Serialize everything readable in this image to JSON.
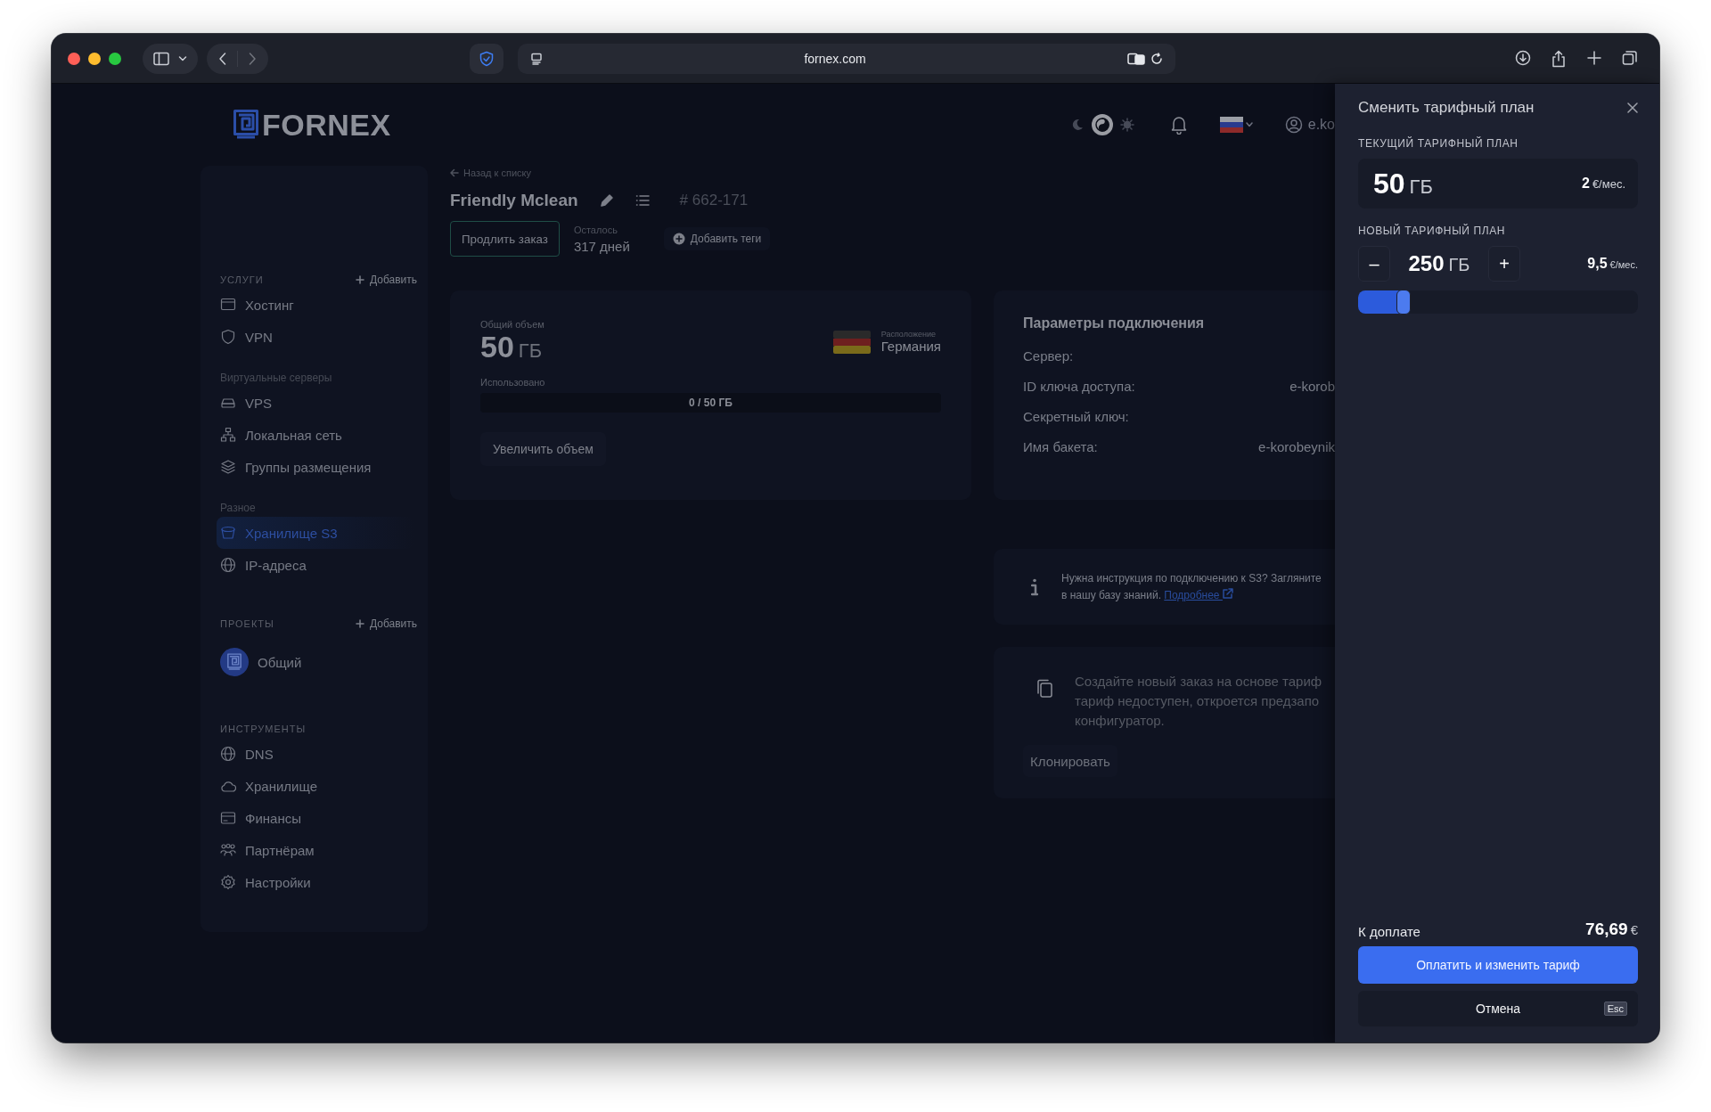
{
  "browser": {
    "url": "fornex.com"
  },
  "logo": {
    "text": "FORNEX"
  },
  "header": {
    "theme_modes": [
      {
        "selected": false
      },
      {
        "selected": true
      },
      {
        "selected": false
      }
    ],
    "user": "e.ko"
  },
  "sidebar": {
    "sections": [
      {
        "kind": "section",
        "title": "УСЛУГИ",
        "action": "Добавить",
        "items": [
          {
            "label": "Хостинг",
            "selected": false
          },
          {
            "label": "VPN",
            "selected": false
          }
        ]
      },
      {
        "kind": "subsection",
        "title": "Виртуальные серверы",
        "items": [
          {
            "label": "VPS",
            "selected": false
          },
          {
            "label": "Локальная сеть",
            "selected": false
          },
          {
            "label": "Группы размещения",
            "selected": false
          }
        ]
      },
      {
        "kind": "subsection",
        "title": "Разное",
        "items": [
          {
            "label": "Хранилище S3",
            "selected": true
          },
          {
            "label": "IP-адреса",
            "selected": false
          }
        ]
      },
      {
        "kind": "section",
        "title": "ПРОЕКТЫ",
        "action": "Добавить",
        "items": [
          {
            "label": "Общий",
            "selected": false,
            "kind": "project"
          }
        ]
      },
      {
        "kind": "section",
        "title": "ИНСТРУМЕНТЫ",
        "items": [
          {
            "label": "DNS",
            "selected": false
          },
          {
            "label": "Хранилище",
            "selected": false
          },
          {
            "label": "Финансы",
            "selected": false
          },
          {
            "label": "Партнёрам",
            "selected": false
          },
          {
            "label": "Настройки",
            "selected": false
          }
        ]
      }
    ]
  },
  "order": {
    "back": "Назад к списку",
    "title": "Friendly Mclean",
    "number": "# 662-171",
    "renew": "Продлить заказ",
    "remaining_label": "Осталось",
    "remaining": "317 дней",
    "add_tags": "Добавить теги"
  },
  "volume": {
    "total_label": "Общий объем",
    "total_value": "50",
    "total_unit": "ГБ",
    "location_label": "Расположение",
    "location": "Германия",
    "used_label": "Использовано",
    "usage": "0 / 50 ГБ",
    "level": 0,
    "button": "Увеличить объем"
  },
  "connection": {
    "title": "Параметры подключения",
    "rows": [
      {
        "label": "Сервер:"
      },
      {
        "label": "ID ключа доступа:",
        "value": "e-korob"
      },
      {
        "label": "Секретный ключ:"
      },
      {
        "label": "Имя бакета:",
        "value": "e-korobeynik"
      }
    ]
  },
  "help": {
    "text": "Нужна инструкция по подключению к S3? Загляните в нашу базу знаний.",
    "link": "Подробнее"
  },
  "clone": {
    "lines": [
      "Создайте новый заказ на основе тариф",
      "тариф недоступен, откроется предзапо",
      "конфигуратор."
    ],
    "button": "Клонировать"
  },
  "plan": {
    "title": "Сменить тарифный план",
    "current_label": "ТЕКУЩИЙ ТАРИФНЫЙ ПЛАН",
    "current": {
      "value": "50",
      "unit": "ГБ",
      "price": "2",
      "price_unit": "€/мес."
    },
    "new_label": "НОВЫЙ ТАРИФНЫЙ ПЛАН",
    "new": {
      "minus": "–",
      "value": "250",
      "unit": "ГБ",
      "plus": "+",
      "price": "9,5",
      "price_unit": "€/мес.",
      "level": 0.18
    },
    "total_label": "К доплате",
    "total": "76,69",
    "currency": "€",
    "pay": "Оплатить и изменить тариф",
    "cancel": "Отмена",
    "esc": "Esc"
  }
}
